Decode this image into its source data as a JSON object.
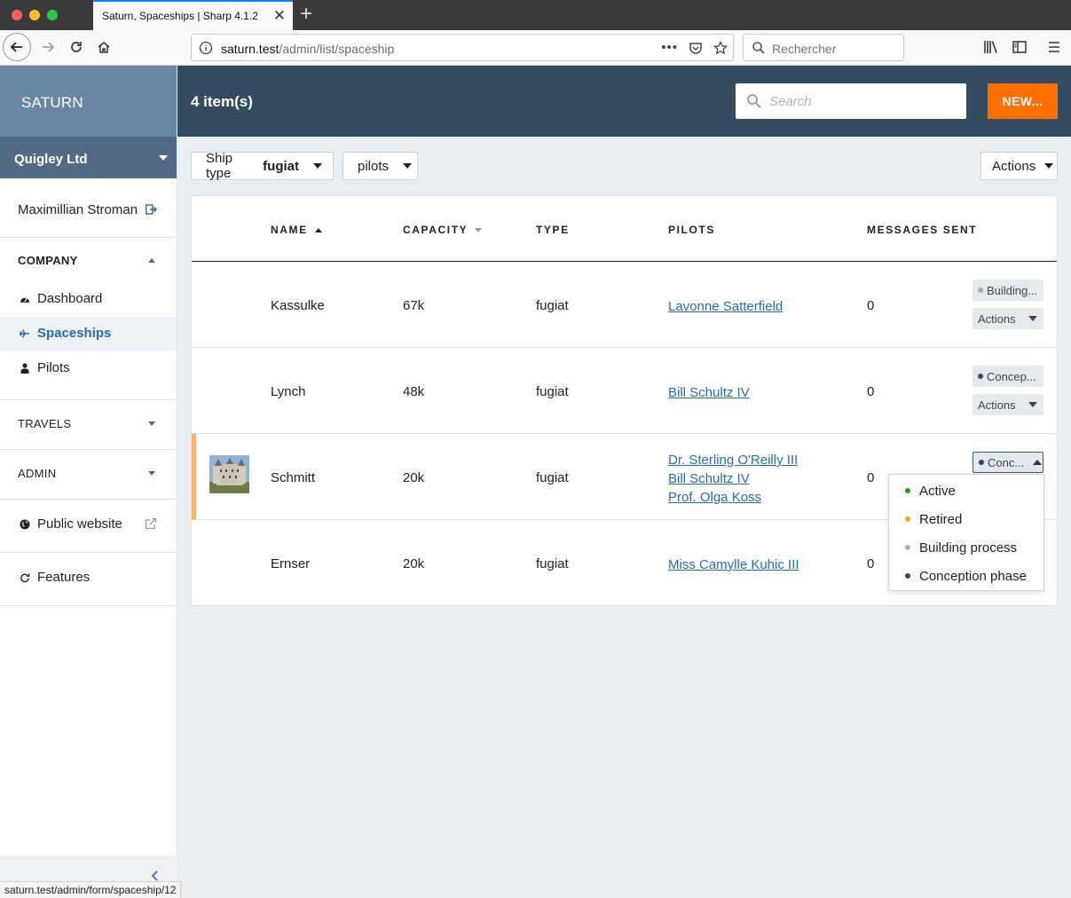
{
  "browser": {
    "tab_title": "Saturn, Spaceships | Sharp 4.1.2",
    "url_host": "saturn.test",
    "url_path": "/admin/list/spaceship",
    "search_placeholder": "Rechercher",
    "status_url": "saturn.test/admin/form/spaceship/12"
  },
  "sidebar": {
    "brand": "SATURN",
    "company": "Quigley Ltd",
    "user": "Maximillian Stroman",
    "section_company": "COMPANY",
    "items": [
      {
        "label": "Dashboard",
        "icon": "dashboard-icon"
      },
      {
        "label": "Spaceships",
        "icon": "plane-icon",
        "active": true
      },
      {
        "label": "Pilots",
        "icon": "user-icon"
      }
    ],
    "section_travels": "TRAVELS",
    "section_admin": "ADMIN",
    "public_website": "Public website",
    "features": "Features"
  },
  "header": {
    "count": "4 item(s)",
    "search_placeholder": "Search",
    "new_label": "NEW..."
  },
  "filters": {
    "ship_type_label": "Ship type",
    "ship_type_value": "fugiat",
    "pilots_label": "pilots",
    "actions_label": "Actions"
  },
  "table": {
    "columns": [
      "NAME",
      "CAPACITY",
      "TYPE",
      "PILOTS",
      "MESSAGES SENT"
    ],
    "rows": [
      {
        "name": "Kassulke",
        "capacity": "67k",
        "type": "fugiat",
        "pilots": [
          "Lavonne Satterfield"
        ],
        "messages": "0",
        "state": "Building...",
        "state_color": "#a6adb4",
        "actions": "Actions"
      },
      {
        "name": "Lynch",
        "capacity": "48k",
        "type": "fugiat",
        "pilots": [
          "Bill Schultz IV"
        ],
        "messages": "0",
        "state": "Concep...",
        "state_color": "#3a4550",
        "actions": "Actions"
      },
      {
        "name": "Schmitt",
        "capacity": "20k",
        "type": "fugiat",
        "pilots": [
          "Dr. Sterling O'Reilly III",
          "Bill Schultz IV",
          "Prof. Olga Koss"
        ],
        "messages": "0",
        "state": "Conc...",
        "state_color": "#3a4550"
      },
      {
        "name": "Ernser",
        "capacity": "20k",
        "type": "fugiat",
        "pilots": [
          "Miss Camylle Kuhic III"
        ],
        "messages": "0"
      }
    ]
  },
  "state_menu": [
    {
      "label": "Active",
      "color": "#1a9e1a"
    },
    {
      "label": "Retired",
      "color": "#f5a623"
    },
    {
      "label": "Building process",
      "color": "#a6adb4"
    },
    {
      "label": "Conception phase",
      "color": "#3a4550"
    }
  ],
  "colors": {
    "accent": "#ff6f00",
    "topbar": "#344a5f",
    "link": "#2a6ab3"
  }
}
